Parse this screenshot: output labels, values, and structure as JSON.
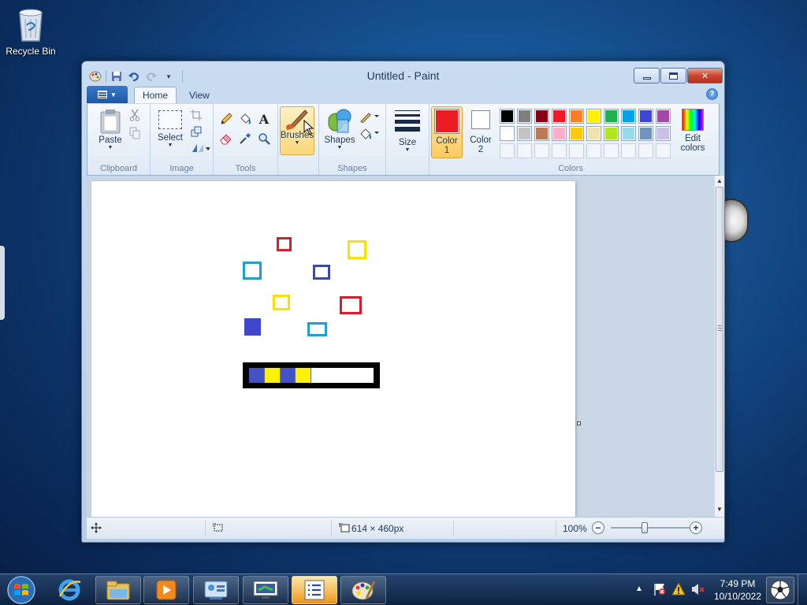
{
  "desktop": {
    "recycle_bin_label": "Recycle Bin"
  },
  "window": {
    "title": "Untitled - Paint",
    "qat_icons": [
      "paint-app-icon",
      "save-icon",
      "undo-icon",
      "redo-icon",
      "customize-arrow-icon"
    ]
  },
  "ribbon": {
    "tabs": [
      {
        "label": "Home",
        "active": true
      },
      {
        "label": "View",
        "active": false
      }
    ],
    "clipboard": {
      "group_label": "Clipboard",
      "paste_label": "Paste"
    },
    "image": {
      "group_label": "Image",
      "select_label": "Select"
    },
    "tools": {
      "group_label": "Tools"
    },
    "brushes": {
      "label": "Brushes"
    },
    "shapes": {
      "group_label": "Shapes",
      "shapes_label": "Shapes"
    },
    "size": {
      "label": "Size"
    },
    "colors": {
      "group_label": "Colors",
      "color1_label": "Color",
      "color1_num": "1",
      "color2_label": "Color",
      "color2_num": "2",
      "edit_label_1": "Edit",
      "edit_label_2": "colors",
      "color1_value": "#ed1c24",
      "color2_value": "#ffffff",
      "palette_row1": [
        "#000000",
        "#7f7f7f",
        "#880015",
        "#ed1c24",
        "#ff7f27",
        "#fff200",
        "#22b14c",
        "#00a2e8",
        "#3f48cc",
        "#a349a4"
      ],
      "palette_row2": [
        "#ffffff",
        "#c3c3c3",
        "#b97a57",
        "#ffaec9",
        "#ffc90e",
        "#efe4b0",
        "#b5e61d",
        "#99d9ea",
        "#7092be",
        "#c8bfe7"
      ]
    }
  },
  "canvas": {
    "shapes": [
      {
        "kind": "outline-rect",
        "color": "#d0202e"
      },
      {
        "kind": "outline-rect",
        "color": "#f5e200"
      },
      {
        "kind": "outline-rect",
        "color": "#1f9fd0"
      },
      {
        "kind": "outline-rect",
        "color": "#3f48aa"
      },
      {
        "kind": "outline-rect",
        "color": "#f5e200"
      },
      {
        "kind": "outline-rect",
        "color": "#d0202e"
      },
      {
        "kind": "filled-rect",
        "color": "#3f48cc"
      },
      {
        "kind": "outline-rect",
        "color": "#1f9fd0"
      }
    ],
    "bar": {
      "segments": [
        "#4450c8",
        "#fff200",
        "#4450c8",
        "#fff200"
      ],
      "fill_fraction": 0.5
    }
  },
  "statusbar": {
    "dimensions": "614 × 460px",
    "zoom": "100%"
  },
  "taskbar": {
    "apps": [
      "internet-explorer-icon",
      "file-explorer-icon",
      "media-player-icon",
      "control-panel-icon",
      "remote-desktop-icon",
      "task-list-icon",
      "paint-icon"
    ],
    "time": "7:49 PM",
    "date": "10/10/2022"
  }
}
